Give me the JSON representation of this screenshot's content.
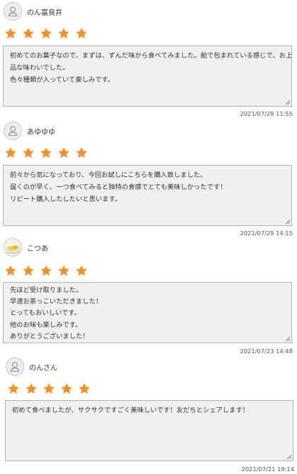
{
  "colors": {
    "star": "#f7901e",
    "box_background": "#f0f0f0",
    "box_border": "#b5b5b5"
  },
  "reviews": [
    {
      "user": "のん富良井",
      "avatar_icon": "default-user-icon",
      "rating": 5,
      "lines": [
        "初めてのお菓子なので、まずは、ずんだ味から食べてみました。飴で包まれている感じで、お上",
        "品な味わいでした。",
        "色々種類が入っていて楽しみです。"
      ],
      "date": "2021/07/29 11:55"
    },
    {
      "user": "あゆゆゆ",
      "avatar_icon": "default-user-icon",
      "rating": 5,
      "lines": [
        "前々から気になっており、今回お試しにこちらを購入致しました。",
        "届くのが早く、一つ食べてみると独特の食感でとても美味しかったです！",
        "リピート購入したしたいと思います。"
      ],
      "date": "2021/07/29 14:15"
    },
    {
      "user": "こつあ",
      "avatar_icon": "photo-avatar",
      "rating": 5,
      "lines": [
        "先ほど受け取りました。",
        "早速お茶っこいただきました！",
        "とってもおいしいです。",
        "他のお味も楽しみです。",
        "ありがとうございました！"
      ],
      "date": "2021/07/23 14:48"
    },
    {
      "user": "のんさん",
      "avatar_icon": "default-user-icon",
      "rating": 5,
      "lines": [
        "初めて食べましたが、サクサクですごく美味しいです！友だちとシェアします！"
      ],
      "date": "2021/07/21 19:14"
    }
  ]
}
